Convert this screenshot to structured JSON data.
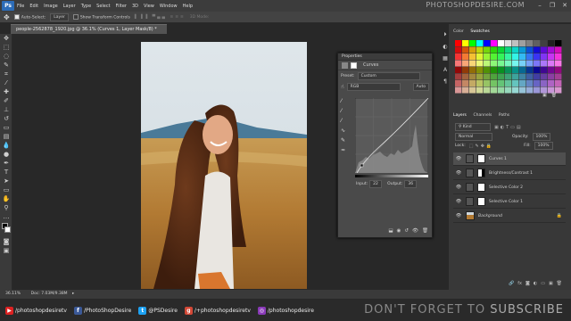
{
  "menubar": {
    "logo": "Ps",
    "items": [
      "File",
      "Edit",
      "Image",
      "Layer",
      "Type",
      "Select",
      "Filter",
      "3D",
      "View",
      "Window",
      "Help"
    ],
    "watermark": "PHOTOSHOPDESIRE.COM"
  },
  "options": {
    "auto_select_label": "Auto-Select:",
    "auto_select_value": "Layer",
    "transform_label": "Show Transform Controls",
    "mode_label": "3D Mode:"
  },
  "document": {
    "tab_title": "people-2562878_1920.jpg @ 36.1% (Curves 1, Layer Mask/8) *",
    "zoom": "36.11%",
    "doc_size": "Doc: 7.03M/9.38M"
  },
  "properties": {
    "header": "Properties",
    "title": "Curves",
    "preset_label": "Preset:",
    "preset_value": "Custom",
    "channel": "RGB",
    "auto": "Auto",
    "input_label": "Input:",
    "input_value": "22",
    "output_label": "Output:",
    "output_value": "36"
  },
  "panels": {
    "color_tab": "Color",
    "swatches_tab": "Swatches",
    "layers_tab": "Layers",
    "channels_tab": "Channels",
    "paths_tab": "Paths",
    "kind": "Kind",
    "blend_mode": "Normal",
    "opacity_label": "Opacity:",
    "opacity_value": "100%",
    "lock_label": "Lock:",
    "fill_label": "Fill:",
    "fill_value": "100%"
  },
  "layers": [
    {
      "name": "Curves 1"
    },
    {
      "name": "Brightness/Contrast 1"
    },
    {
      "name": "Selective Color 2"
    },
    {
      "name": "Selective Color 1"
    },
    {
      "name": "Background"
    }
  ],
  "social": [
    {
      "icon": "youtube-icon",
      "label": "/photoshopdesiretv",
      "color": "#d22"
    },
    {
      "icon": "facebook-icon",
      "label": "/PhotoShopDesire",
      "color": "#3b5998"
    },
    {
      "icon": "twitter-icon",
      "label": "@PSDesire",
      "color": "#1da1f2"
    },
    {
      "icon": "googleplus-icon",
      "label": "/+photoshopdesiretv",
      "color": "#d34836"
    },
    {
      "icon": "instagram-icon",
      "label": "/photoshopdesire",
      "color": "#8a3ab9"
    }
  ],
  "subscribe": {
    "prefix": "DON'T FORGET TO ",
    "word": "SUBSCRIBE"
  }
}
